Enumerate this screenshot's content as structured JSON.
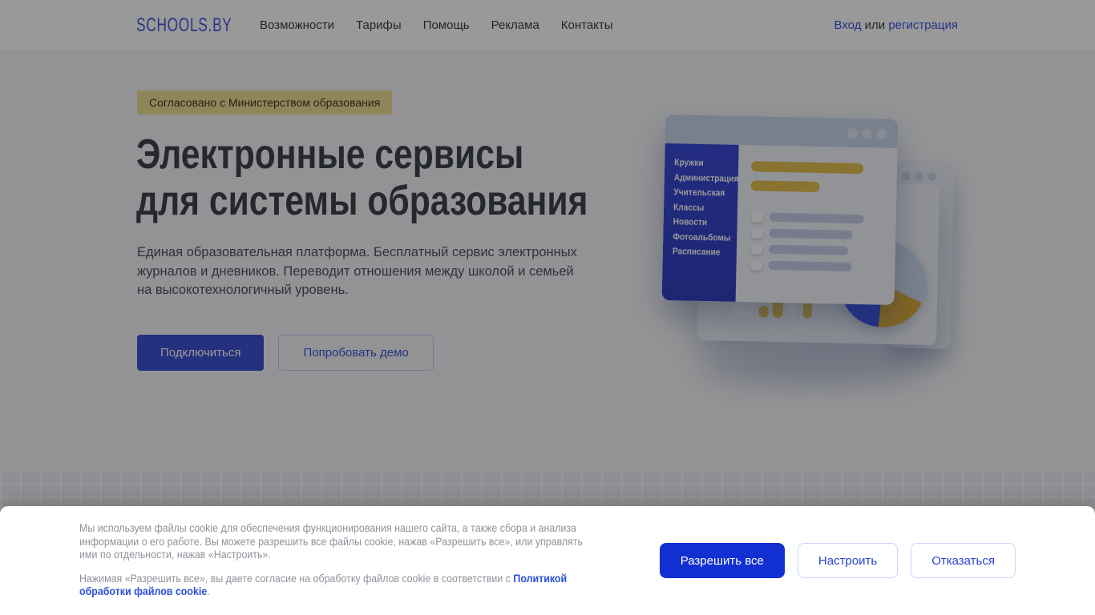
{
  "brand": {
    "logo": "SCHOOLS.BY"
  },
  "navbar": {
    "links": [
      "Возможности",
      "Тарифы",
      "Помощь",
      "Реклама",
      "Контакты"
    ],
    "auth": {
      "login": "Вход",
      "or": " или ",
      "register": "регистрация"
    }
  },
  "hero": {
    "badge": "Согласовано с Министерством образования",
    "title_line1": "Электронные сервисы",
    "title_line2": "для системы образования",
    "description": "Единая образовательная платформа. Бесплатный сервис электронных журналов и дневников. Переводит отношения между школой и семьей на высокотехнологичный уровень.",
    "primary_button": "Подключиться",
    "secondary_button": "Попробовать демо"
  },
  "illustration": {
    "menu_items": [
      "Кружки",
      "Администрация",
      "Учительская",
      "Классы",
      "Новости",
      "Фотоальбомы",
      "Расписание"
    ]
  },
  "cookie_banner": {
    "paragraph1": "Мы используем файлы cookie для обеспечения функционирования нашего сайта, а также сбора и анализа информации о его работе. Вы можете разрешить все файлы cookie, нажав «Разрешить все», или управлять ими по отдельности, нажав «Настроить».",
    "paragraph2_prefix": "Нажимая «Разрешить все», вы даете согласие на обработку файлов cookie в соответствии с ",
    "policy_link": "Политикой обработки файлов cookie",
    "paragraph2_suffix": ".",
    "buttons": {
      "accept": "Разрешить все",
      "configure": "Настроить",
      "decline": "Отказаться"
    }
  },
  "colors": {
    "accent_blue": "#1230d2",
    "hero_button_blue": "#3f51d4",
    "logo_blue": "#4656e0",
    "badge_gold": "#f0dc94",
    "illustration_yellow": "#e3c052",
    "pie_blue": "#3c55f0",
    "sidebar_blue": "#3a4ad6",
    "overlay": "rgba(0,0,0,0.4)"
  }
}
